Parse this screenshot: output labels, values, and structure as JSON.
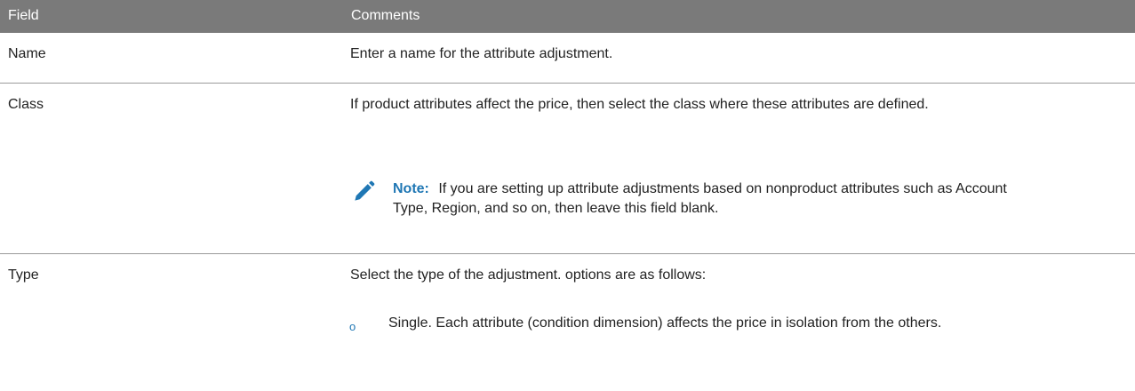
{
  "header": {
    "field": "Field",
    "comments": "Comments"
  },
  "rows": [
    {
      "field": "Name",
      "comment": "Enter a name for the attribute adjustment."
    },
    {
      "field": "Class",
      "comment": "If product attributes affect the price, then select the class where these attributes are defined.",
      "note": {
        "label": "Note:",
        "text": "If you are setting up attribute adjustments based on nonproduct attributes such as Account Type, Region, and so on, then leave this field blank.",
        "icon": "pencil-icon"
      }
    },
    {
      "field": "Type",
      "comment": "Select the type of the adjustment. options are as follows:",
      "options": [
        {
          "bullet": "o",
          "text": "Single. Each attribute (condition dimension) affects the price in isolation from the others."
        }
      ]
    }
  ],
  "colors": {
    "header_bg": "#7a7a7a",
    "header_text": "#ffffff",
    "accent": "#1f77b4"
  }
}
